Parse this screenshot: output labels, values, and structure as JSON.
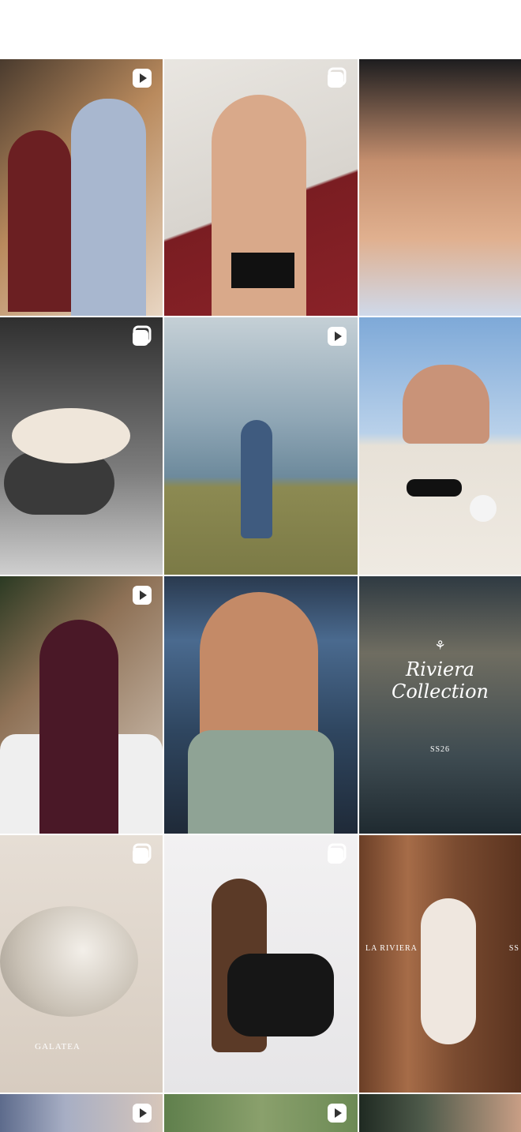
{
  "profile_grid": {
    "posts": [
      {
        "id": "post-1",
        "type": "reel",
        "badge_icon": "reel-play-icon"
      },
      {
        "id": "post-2",
        "type": "carousel",
        "badge_icon": "carousel-icon"
      },
      {
        "id": "post-3",
        "type": "photo"
      },
      {
        "id": "post-4",
        "type": "carousel",
        "badge_icon": "carousel-icon"
      },
      {
        "id": "post-5",
        "type": "reel",
        "badge_icon": "reel-play-icon"
      },
      {
        "id": "post-6",
        "type": "photo"
      },
      {
        "id": "post-7",
        "type": "reel",
        "badge_icon": "reel-play-icon"
      },
      {
        "id": "post-8",
        "type": "photo"
      },
      {
        "id": "post-9",
        "type": "photo",
        "caption_title": "Riviera Collection",
        "caption_sub": "SS26"
      },
      {
        "id": "post-10",
        "type": "carousel",
        "badge_icon": "carousel-icon",
        "caption": "GALATEA"
      },
      {
        "id": "post-11",
        "type": "carousel",
        "badge_icon": "carousel-icon"
      },
      {
        "id": "post-12",
        "type": "photo",
        "caption_left": "LA RIVIERA",
        "caption_right": "SS"
      },
      {
        "id": "post-13",
        "type": "reel",
        "badge_icon": "reel-play-icon"
      },
      {
        "id": "post-14",
        "type": "reel",
        "badge_icon": "reel-play-icon"
      },
      {
        "id": "post-15",
        "type": "photo"
      }
    ]
  },
  "colors": {
    "background": "#ffffff",
    "badge": "#ffffff"
  }
}
